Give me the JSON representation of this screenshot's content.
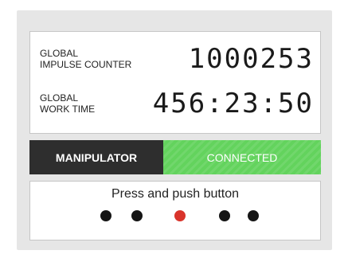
{
  "counters": [
    {
      "label_line1": "GLOBAL",
      "label_line2": "IMPULSE COUNTER",
      "value": "1000253"
    },
    {
      "label_line1": "GLOBAL",
      "label_line2": "WORK TIME",
      "value": "456:23:50"
    }
  ],
  "status": {
    "name": "MANIPULATOR",
    "value": "CONNECTED"
  },
  "button_panel": {
    "prompt": "Press and push button",
    "buttons": [
      {
        "name": "button-1",
        "color": "#151515"
      },
      {
        "name": "button-2",
        "color": "#151515"
      },
      {
        "name": "button-3",
        "color": "#d9342b"
      },
      {
        "name": "button-4",
        "color": "#151515"
      },
      {
        "name": "button-5",
        "color": "#151515"
      }
    ]
  },
  "colors": {
    "connected": "#63d35d",
    "status_dark": "#2e2e2e",
    "active_button": "#d9342b"
  }
}
